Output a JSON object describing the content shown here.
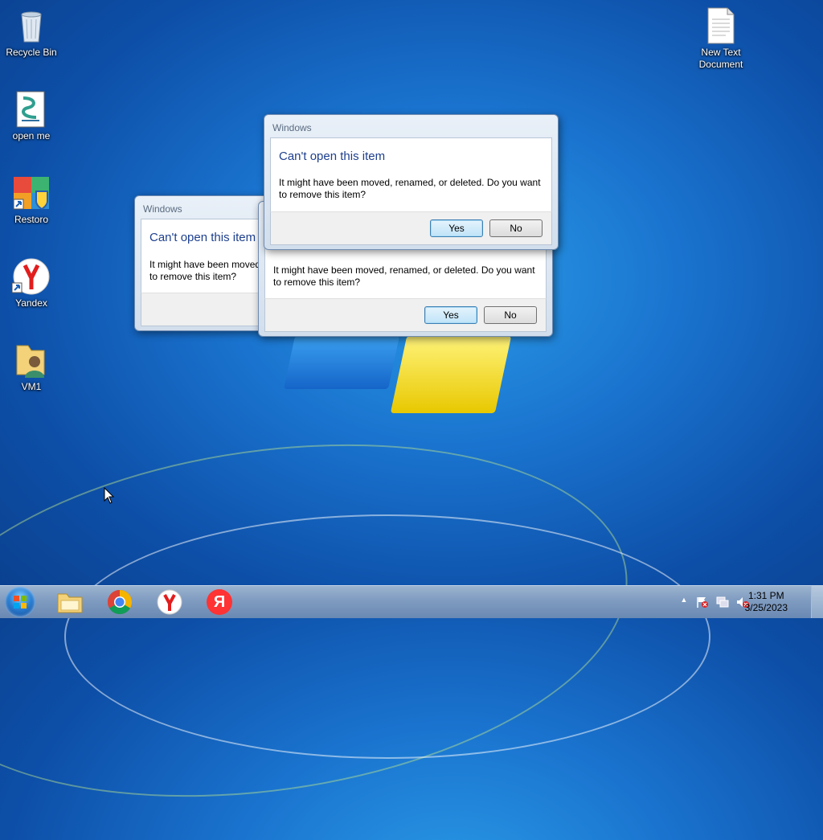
{
  "desktop": {
    "icons": [
      {
        "label": "Recycle Bin"
      },
      {
        "label": "open me"
      },
      {
        "label": "Restoro"
      },
      {
        "label": "Yandex"
      },
      {
        "label": "VM1"
      },
      {
        "label": "New Text Document"
      }
    ]
  },
  "dialogs": {
    "back": {
      "title": "Windows",
      "heading": "Can't open this item",
      "message_line1": "It might have been moved",
      "message_line2": "to remove this item?"
    },
    "middle": {
      "message_line1": "It might have been moved, renamed, or deleted. Do you want",
      "message_line2": "to remove this item?",
      "yes_label": "Yes",
      "no_label": "No"
    },
    "front": {
      "title": "Windows",
      "heading": "Can't open this item",
      "message_line1": "It might have been moved, renamed, or deleted. Do you want",
      "message_line2": "to remove this item?",
      "yes_label": "Yes",
      "no_label": "No"
    }
  },
  "taskbar": {
    "pinned": [
      "windows-explorer",
      "google-chrome",
      "yandex-browser",
      "yandex"
    ],
    "yandex_letter": "Я",
    "tray": {
      "overflow_arrow": "▲",
      "time": "1:31 PM",
      "date": "3/25/2023"
    }
  },
  "colors": {
    "dialog_heading": "#1d3f8e",
    "taskbar": "#7f9bc0",
    "wallpaper": "#1a74cf"
  }
}
